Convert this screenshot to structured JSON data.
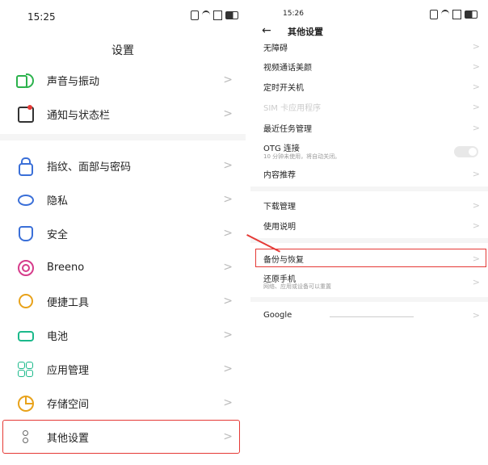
{
  "left": {
    "status_time": "15:25",
    "title": "设置",
    "items": [
      {
        "label": "声音与振动",
        "icon": "sound-icon"
      },
      {
        "label": "通知与状态栏",
        "icon": "notification-icon"
      },
      {
        "label": "指纹、面部与密码",
        "icon": "lock-icon"
      },
      {
        "label": "隐私",
        "icon": "privacy-icon"
      },
      {
        "label": "安全",
        "icon": "shield-icon"
      },
      {
        "label": "Breeno",
        "icon": "breeno-icon"
      },
      {
        "label": "便捷工具",
        "icon": "tools-icon"
      },
      {
        "label": "电池",
        "icon": "battery-icon"
      },
      {
        "label": "应用管理",
        "icon": "apps-icon"
      },
      {
        "label": "存储空间",
        "icon": "storage-icon"
      },
      {
        "label": "其他设置",
        "icon": "other-settings-icon"
      }
    ],
    "chevron": ">"
  },
  "right": {
    "status_time": "15:26",
    "back": "←",
    "title": "其他设置",
    "items": [
      {
        "label": "无障碍"
      },
      {
        "label": "视频通话美颜"
      },
      {
        "label": "定时开关机"
      },
      {
        "label": "SIM 卡应用程序"
      },
      {
        "label": "最近任务管理"
      },
      {
        "label": "OTG 连接",
        "sub": "10 分钟未使用，将自动关闭。"
      },
      {
        "label": "内容推荐"
      },
      {
        "label": "下载管理"
      },
      {
        "label": "使用说明"
      },
      {
        "label": "备份与恢复"
      },
      {
        "label": "还原手机",
        "sub": "网络、应用或设备可以重置"
      },
      {
        "label": "Google"
      }
    ],
    "chevron": ">"
  },
  "colors": {
    "highlight": "#e53935",
    "accent_green": "#1bb98b",
    "accent_blue": "#3a6fd8"
  }
}
